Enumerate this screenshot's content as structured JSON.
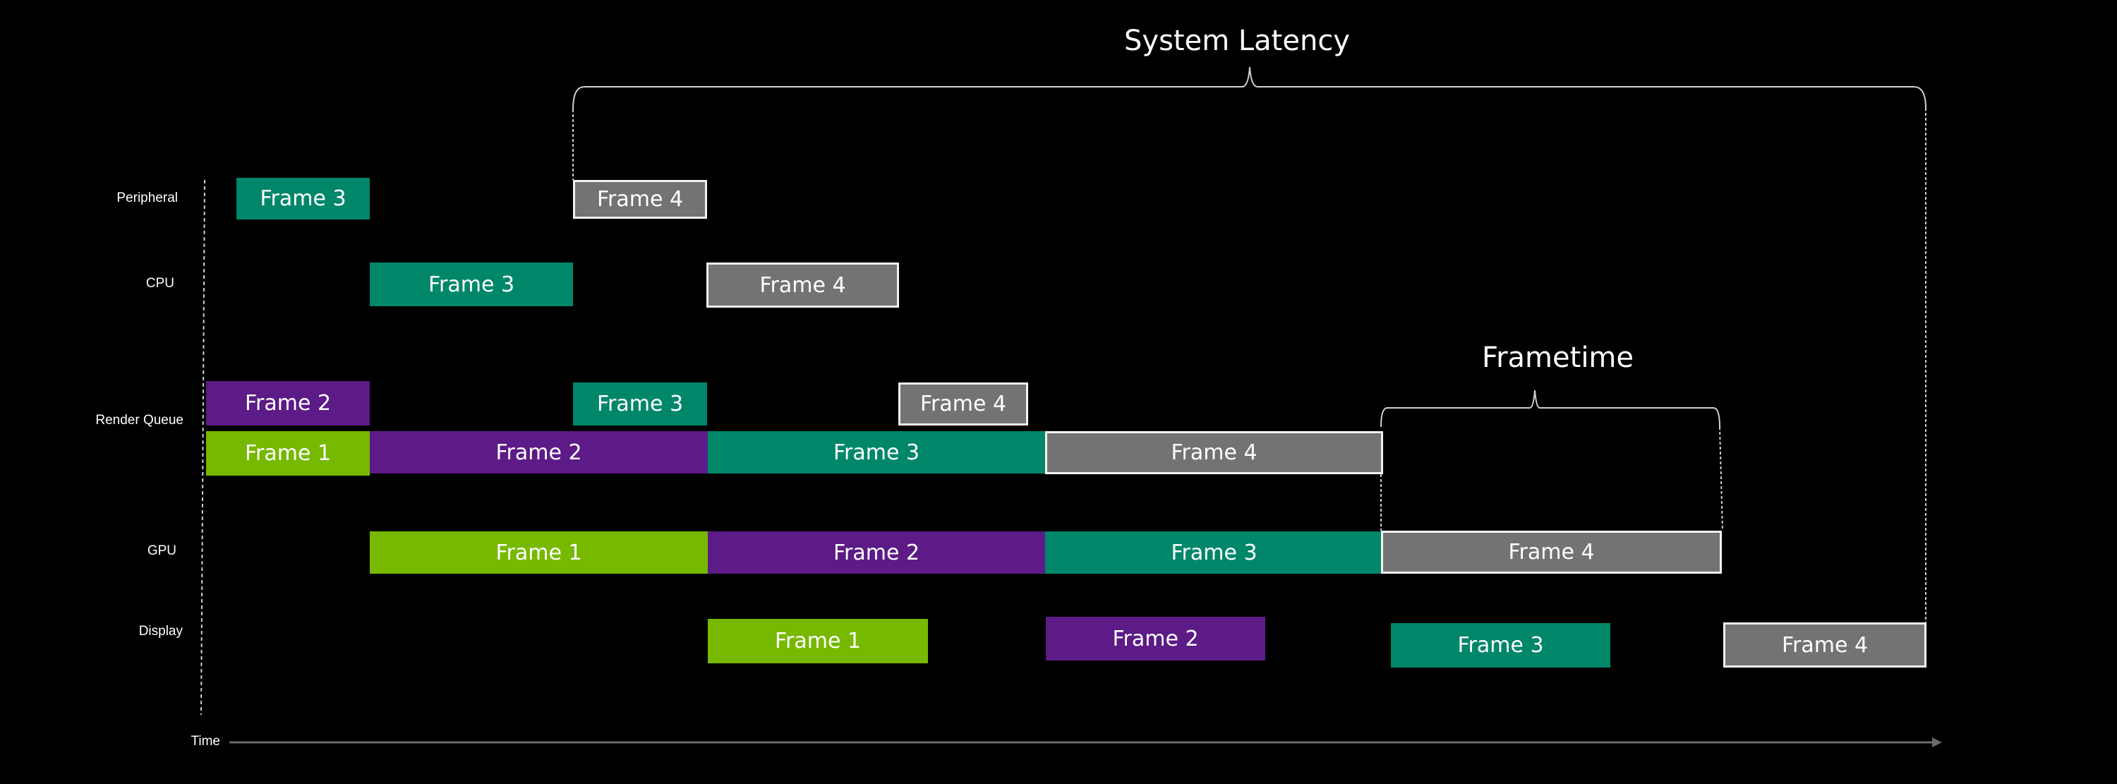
{
  "annotations": {
    "system_latency": "System Latency",
    "frametime": "Frametime"
  },
  "rows": {
    "peripheral": "Peripheral",
    "cpu": "CPU",
    "render_queue": "Render Queue",
    "gpu": "GPU",
    "display": "Display"
  },
  "axis": {
    "time_label": "Time"
  },
  "colors": {
    "frame1": "#76B900",
    "frame2": "#5C1B86",
    "frame3": "#00876A",
    "frame4": "#737373"
  },
  "blocks": {
    "peripheral_f3": "Frame 3",
    "peripheral_f4": "Frame 4",
    "cpu_f3": "Frame 3",
    "cpu_f4": "Frame 4",
    "rq_top_f2": "Frame 2",
    "rq_top_f3": "Frame 3",
    "rq_top_f4": "Frame 4",
    "rq_f1": "Frame 1",
    "rq_f2": "Frame 2",
    "rq_f3": "Frame 3",
    "rq_f4": "Frame 4",
    "gpu_f1": "Frame 1",
    "gpu_f2": "Frame 2",
    "gpu_f3": "Frame 3",
    "gpu_f4": "Frame 4",
    "display_f1": "Frame 1",
    "display_f2": "Frame 2",
    "display_f3": "Frame 3",
    "display_f4": "Frame 4"
  }
}
